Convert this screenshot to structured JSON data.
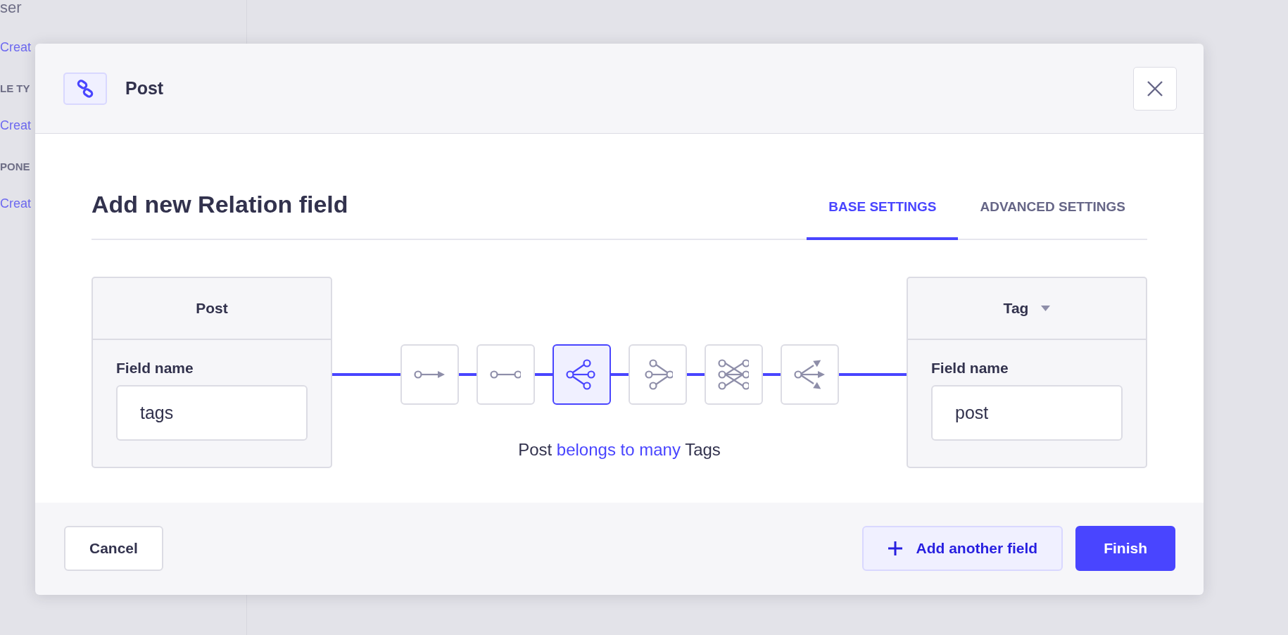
{
  "background": {
    "sidebar_texts": [
      {
        "kind": "heading",
        "text": "ser"
      },
      {
        "kind": "link",
        "text": "Creat"
      },
      {
        "kind": "section",
        "text": "LE TY"
      },
      {
        "kind": "link",
        "text": "Creat"
      },
      {
        "kind": "section",
        "text": "PONE"
      },
      {
        "kind": "link",
        "text": "Creat"
      }
    ]
  },
  "modal": {
    "title": "Post",
    "heading": "Add new Relation field",
    "tabs": [
      {
        "label": "BASE SETTINGS",
        "selected": true
      },
      {
        "label": "ADVANCED SETTINGS",
        "selected": false
      }
    ],
    "left_card": {
      "title": "Post",
      "field_label": "Field name",
      "field_value": "tags"
    },
    "relations": [
      {
        "kind": "one-way",
        "selected": false
      },
      {
        "kind": "one-to-one",
        "selected": false
      },
      {
        "kind": "one-to-many",
        "selected": true
      },
      {
        "kind": "many-to-one",
        "selected": false
      },
      {
        "kind": "many-to-many",
        "selected": false
      },
      {
        "kind": "many-way",
        "selected": false
      }
    ],
    "sentence": [
      {
        "text": "Post",
        "highlight": false
      },
      {
        "text": "belongs to many",
        "highlight": true
      },
      {
        "text": "Tags",
        "highlight": false
      }
    ],
    "right_card": {
      "title": "Tag",
      "field_label": "Field name",
      "field_value": "post"
    },
    "buttons": [
      {
        "kind": "secondary",
        "label": "Cancel"
      },
      {
        "kind": "tertiary",
        "label": "Add another field"
      },
      {
        "kind": "primary",
        "label": "Finish"
      }
    ]
  }
}
